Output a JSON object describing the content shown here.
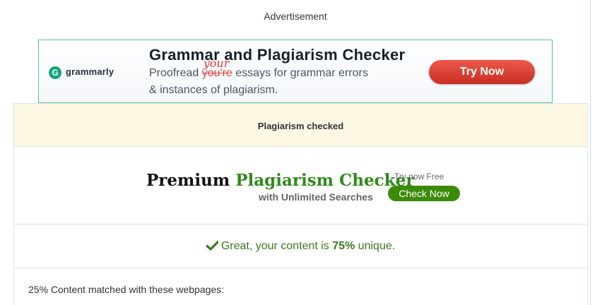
{
  "ad": {
    "label": "Advertisement",
    "logo_letter": "G",
    "brand": "grammarly",
    "title": "Grammar and Plagiarism Checker",
    "line1_prefix": "Proofread ",
    "line1_struck": "you're",
    "line1_correction": "your",
    "line1_suffix": " essays for grammar errors",
    "line2": "& instances of plagiarism.",
    "cta": "Try Now"
  },
  "result": {
    "header": "Plagiarism checked"
  },
  "premium": {
    "title_dark": "Premium ",
    "title_green": "Plagiarism Checker",
    "subtitle": "with Unlimited Searches",
    "try_free": "Try now Free",
    "button": "Check Now"
  },
  "unique": {
    "prefix": "Great, your content is ",
    "percent": "75%",
    "suffix": " unique."
  },
  "matched": {
    "text": "25% Content matched with these webpages:"
  },
  "colors": {
    "accent_green": "#2f8a1c",
    "button_green": "#3b8a08",
    "ad_red": "#c82c22",
    "header_bg": "#fcf8e4"
  }
}
